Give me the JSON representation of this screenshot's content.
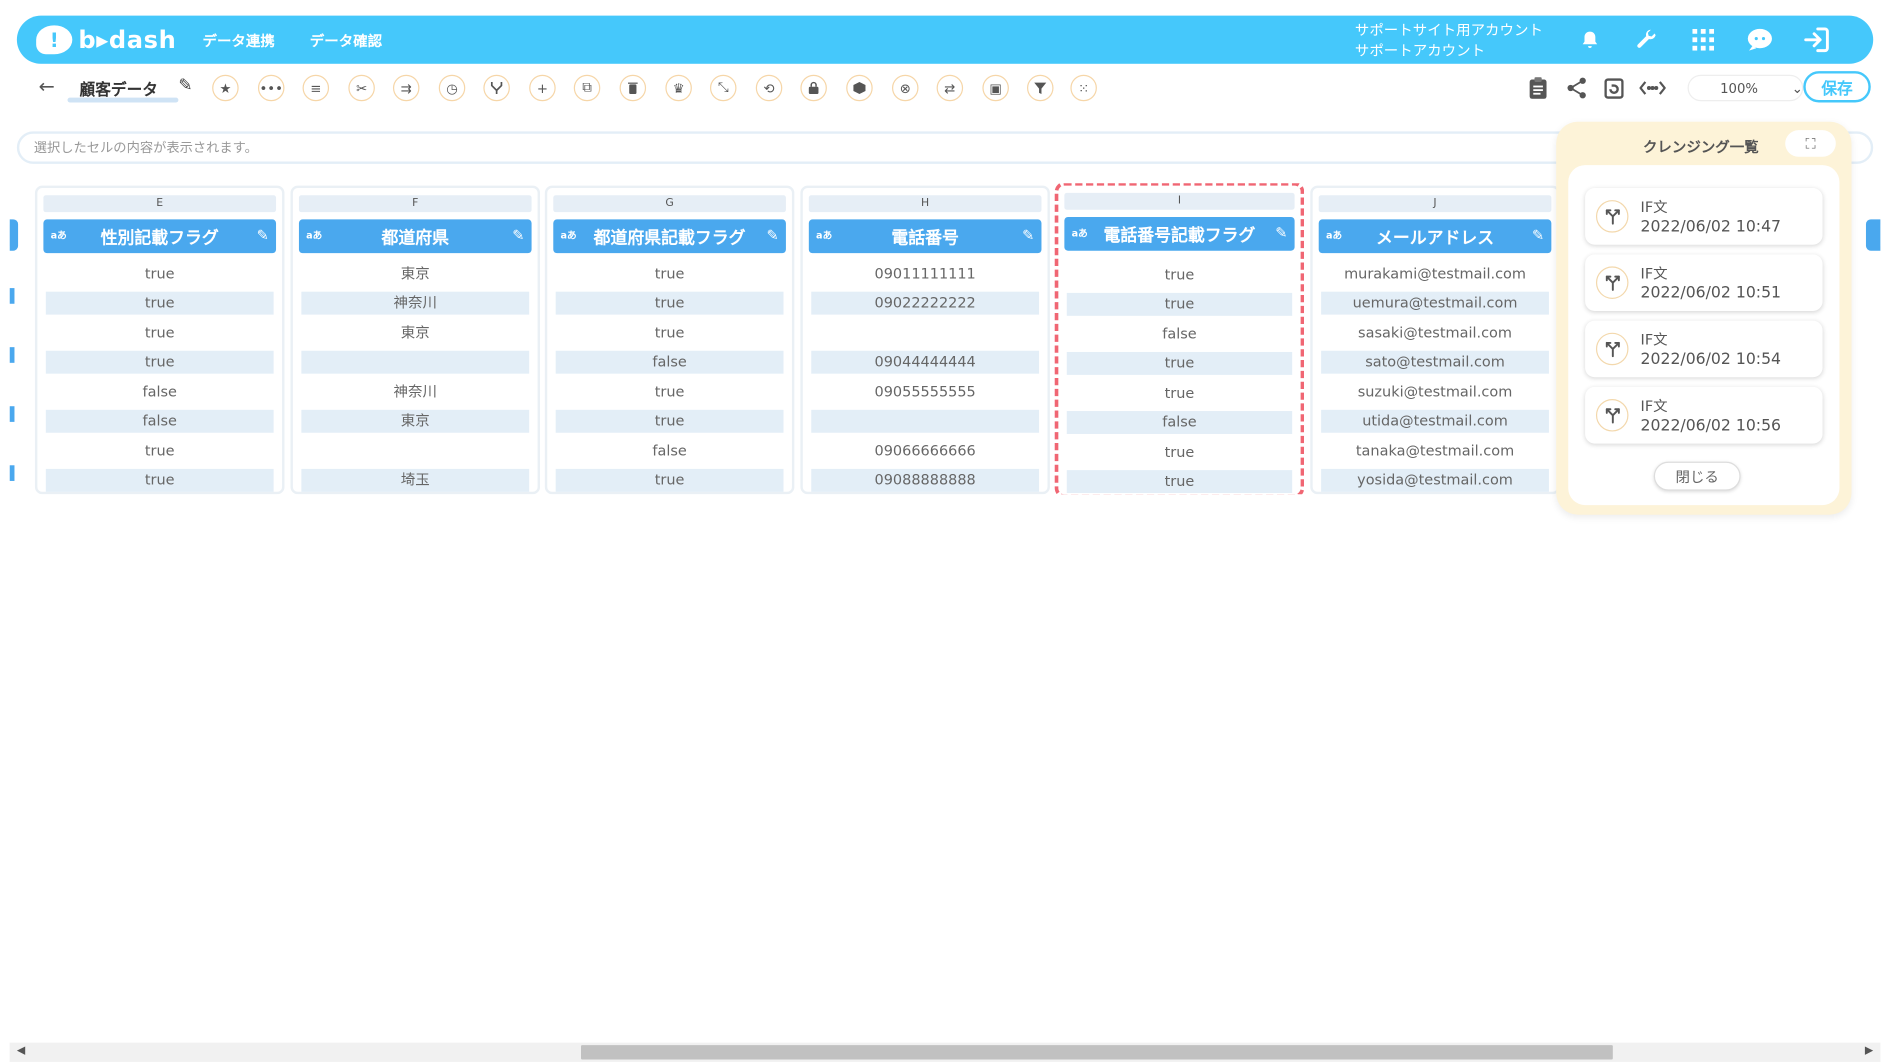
{
  "colors": {
    "header": "#45c8fb",
    "column_header": "#4aa8ee",
    "highlight": "#f06673",
    "panel": "#fdf3d8"
  },
  "header": {
    "logo_text": "b▸dash",
    "nav": [
      "データ連携",
      "データ確認"
    ],
    "account_line1": "サポートサイト用アカウント",
    "account_line2": "サポートアカウント",
    "icons": [
      "bell-icon",
      "wrench-icon",
      "grid-icon",
      "chat-icon",
      "logout-icon"
    ]
  },
  "toolbar": {
    "back": "←",
    "sheet_name": "顧客データ",
    "zoom": "100%",
    "save_label": "保存",
    "tools": [
      "star-icon",
      "more-icon",
      "list-icon",
      "scissors-icon",
      "merge-icon",
      "timer-icon",
      "branch-icon",
      "plus-icon",
      "copy-icon",
      "trash-icon",
      "crown-icon",
      "compress-icon",
      "repeat-icon",
      "lock-icon",
      "box-icon",
      "cancel-icon",
      "translate-icon",
      "frame-icon",
      "filter-icon",
      "grid-dots-icon"
    ],
    "right_icons": [
      "clipboard-icon",
      "share-icon",
      "refresh-icon",
      "code-icon"
    ]
  },
  "cellbar": {
    "placeholder": "選択したセルの内容が表示されます。"
  },
  "grid": {
    "type_label": "aあ",
    "columns": [
      {
        "letter": "E",
        "name": "性別記載フラグ",
        "cells": [
          "true",
          "true",
          "true",
          "true",
          "false",
          "false",
          "true",
          "true"
        ]
      },
      {
        "letter": "F",
        "name": "都道府県",
        "cells": [
          "東京",
          "神奈川",
          "東京",
          "",
          "神奈川",
          "東京",
          "",
          "埼玉"
        ]
      },
      {
        "letter": "G",
        "name": "都道府県記載フラグ",
        "cells": [
          "true",
          "true",
          "true",
          "false",
          "true",
          "true",
          "false",
          "true"
        ]
      },
      {
        "letter": "H",
        "name": "電話番号",
        "cells": [
          "09011111111",
          "09022222222",
          "",
          "09044444444",
          "09055555555",
          "",
          "09066666666",
          "09088888888"
        ]
      },
      {
        "letter": "I",
        "name": "電話番号記載フラグ",
        "cells": [
          "true",
          "true",
          "false",
          "true",
          "true",
          "false",
          "true",
          "true"
        ]
      },
      {
        "letter": "J",
        "name": "メールアドレス",
        "cells": [
          "murakami@testmail.com",
          "uemura@testmail.com",
          "sasaki@testmail.com",
          "sato@testmail.com",
          "suzuki@testmail.com",
          "utida@testmail.com",
          "tanaka@testmail.com",
          "yosida@testmail.com"
        ]
      }
    ]
  },
  "panel": {
    "title": "クレンジング一覧",
    "items": [
      {
        "title": "IF文",
        "date": "2022/06/02 10:47"
      },
      {
        "title": "IF文",
        "date": "2022/06/02 10:51"
      },
      {
        "title": "IF文",
        "date": "2022/06/02 10:54"
      },
      {
        "title": "IF文",
        "date": "2022/06/02 10:56"
      }
    ],
    "close_label": "閉じる"
  }
}
